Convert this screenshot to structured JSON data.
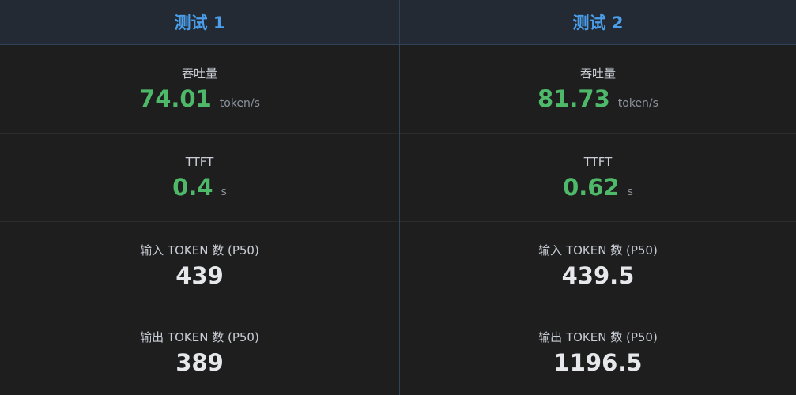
{
  "tests": [
    {
      "title": "测试 1",
      "metrics": [
        {
          "label": "吞吐量",
          "value": "74.01",
          "unit": "token/s"
        },
        {
          "label": "TTFT",
          "value": "0.4",
          "unit": "s"
        },
        {
          "label": "输入 TOKEN 数 (P50)",
          "value": "439",
          "unit": ""
        },
        {
          "label": "输出 TOKEN 数 (P50)",
          "value": "389",
          "unit": ""
        }
      ]
    },
    {
      "title": "测试 2",
      "metrics": [
        {
          "label": "吞吐量",
          "value": "81.73",
          "unit": "token/s"
        },
        {
          "label": "TTFT",
          "value": "0.62",
          "unit": "s"
        },
        {
          "label": "输入 TOKEN 数 (P50)",
          "value": "439.5",
          "unit": ""
        },
        {
          "label": "输出 TOKEN 数 (P50)",
          "value": "1196.5",
          "unit": ""
        }
      ]
    }
  ],
  "colors": {
    "header_text": "#4a9eea",
    "highlight_value": "#4fb96a",
    "plain_value": "#e6e8eb",
    "background": "#1e1e1e"
  }
}
